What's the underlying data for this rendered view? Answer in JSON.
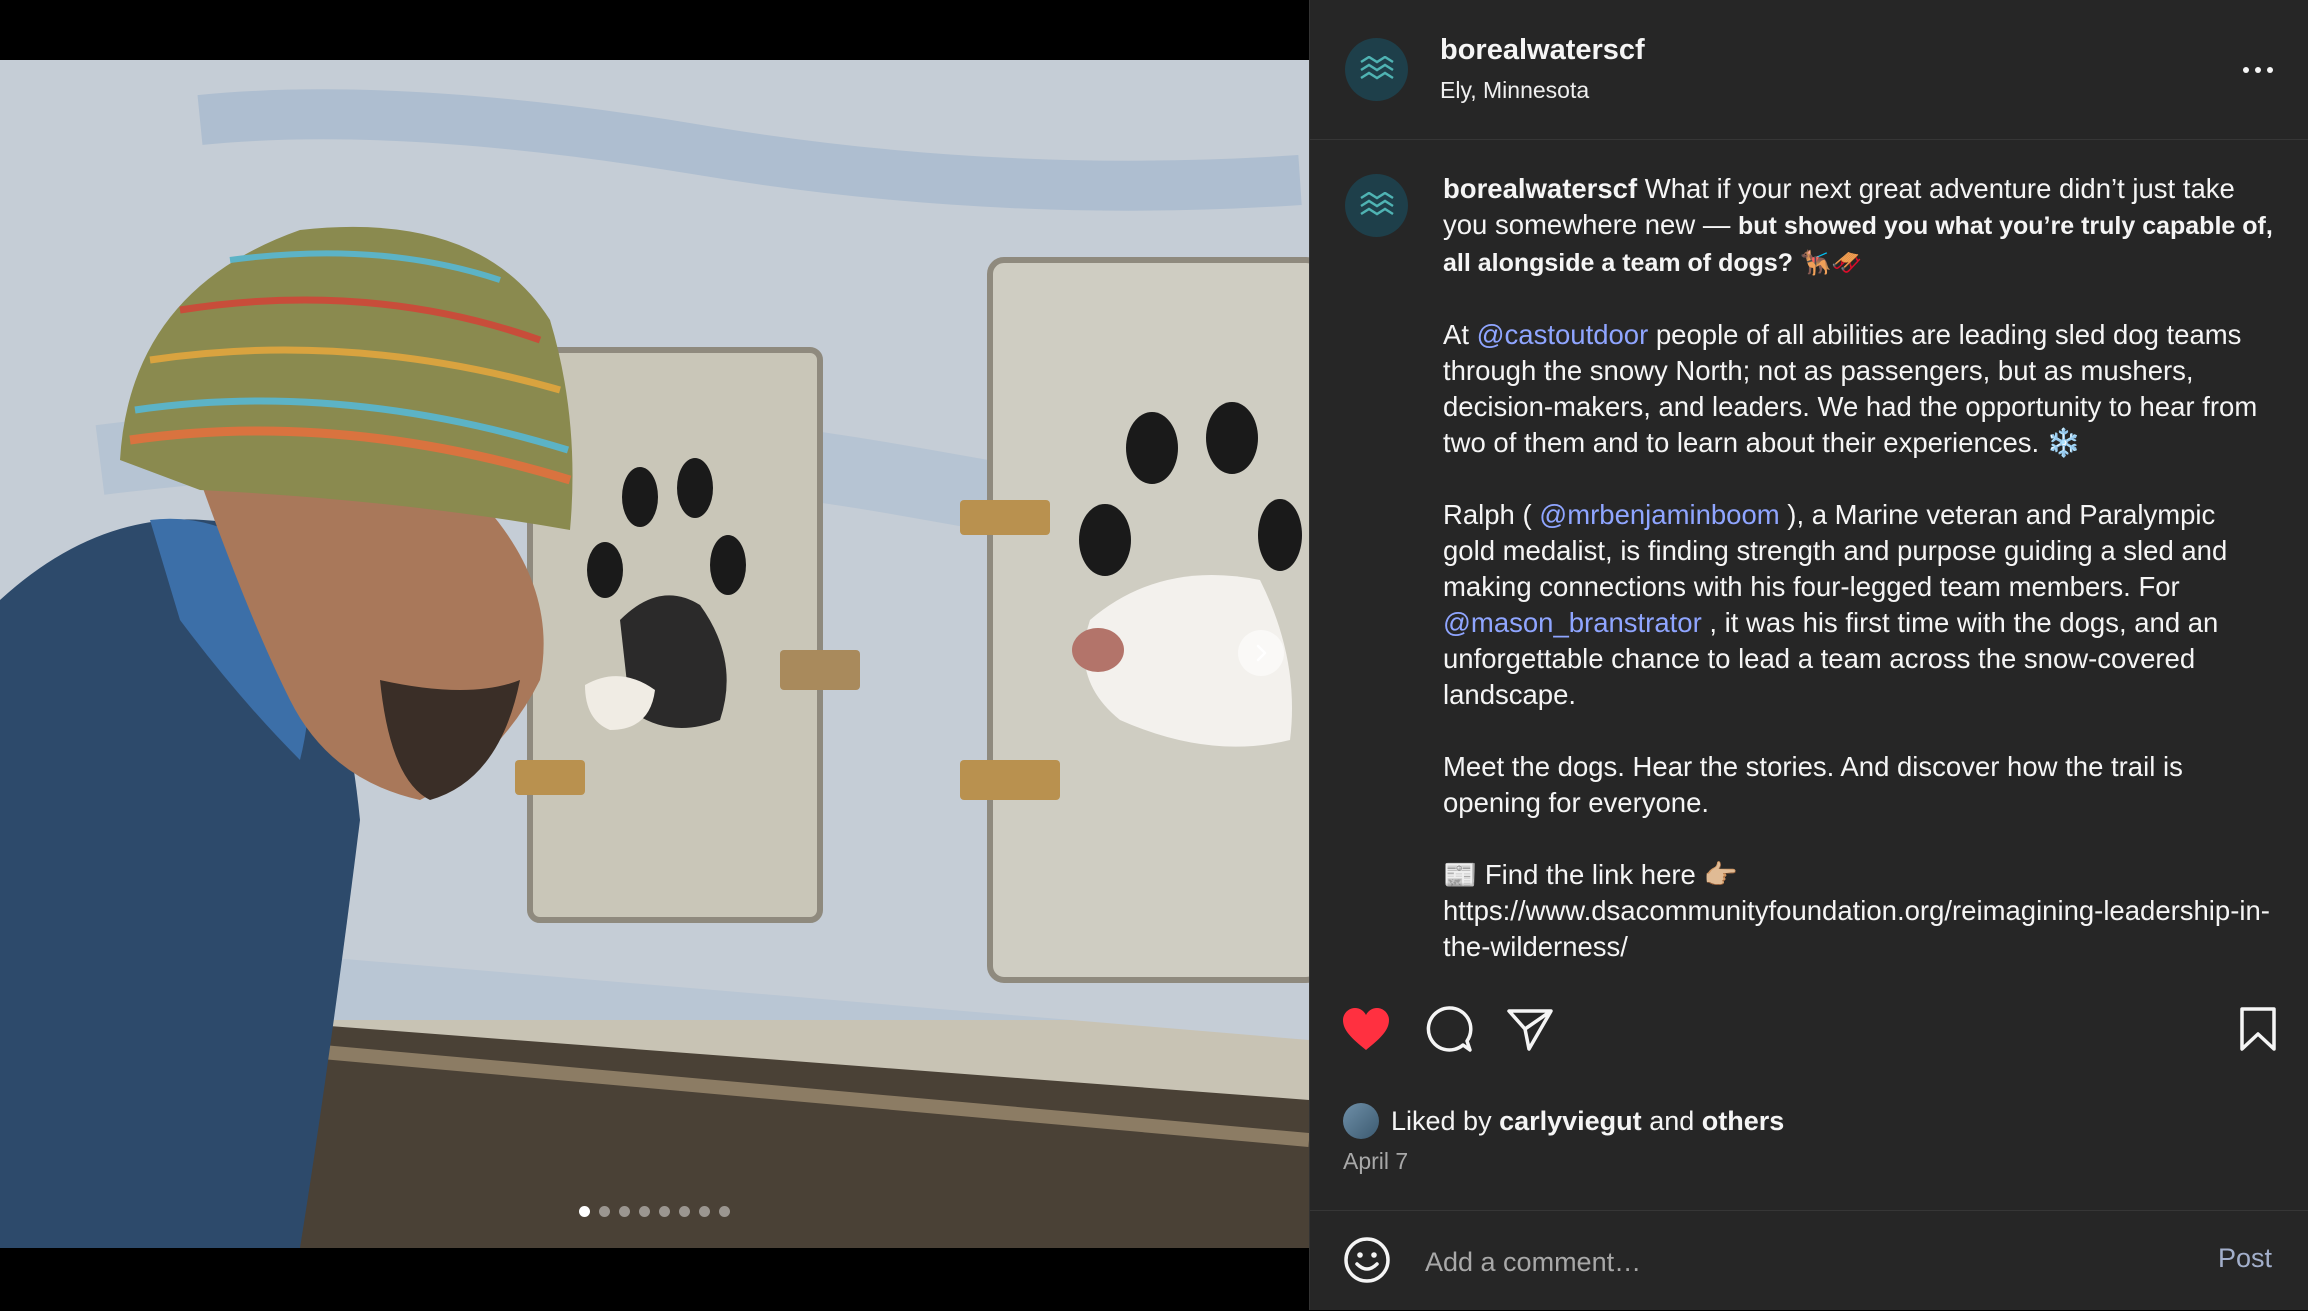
{
  "post": {
    "username": "borealwaterscf",
    "location": "Ely, Minnesota",
    "slide_count": 8,
    "active_slide": 0
  },
  "caption": {
    "username": "borealwaterscf",
    "line1": "What if your next great adventure didn’t just take you somewhere new — ",
    "line1_bold": "but showed you what you’re truly capable of, all alongside a team of dogs? 🐕‍🦺🛷",
    "p2_a": "At ",
    "p2_mention": "@castoutdoor",
    "p2_b": " people of all abilities are leading sled dog teams through the snowy North; not as passengers, but as mushers, decision-makers, and leaders. We had the opportunity to hear from two of them and to learn about their experiences. ❄️",
    "p3_a": "Ralph ( ",
    "p3_mention1": "@mrbenjaminboom",
    "p3_b": " ), a Marine veteran and Paralympic gold medalist, is finding strength and purpose guiding a sled and making connections with his four-legged team members. For ",
    "p3_mention2": "@mason_branstrator",
    "p3_c": " , it was his first time with the dogs, and an unforgettable chance to lead a team across the snow-covered landscape.",
    "p4": "Meet the dogs. Hear the stories. And discover how the trail is opening for everyone.",
    "p5_a": "📰 Find the link here 👉🏼",
    "p5_link": "https://www.dsacommunityfoundation.org/reimagining-leadership-in-the-wilderness/"
  },
  "likes": {
    "prefix": "Liked by ",
    "user": "carlyviegut",
    "middle": " and ",
    "others": "others"
  },
  "date": "April 7",
  "comment": {
    "placeholder": "Add a comment…",
    "post_label": "Post"
  },
  "colors": {
    "panel_bg": "#262626",
    "like_red": "#ff3040",
    "mention": "#8fa5ff"
  }
}
